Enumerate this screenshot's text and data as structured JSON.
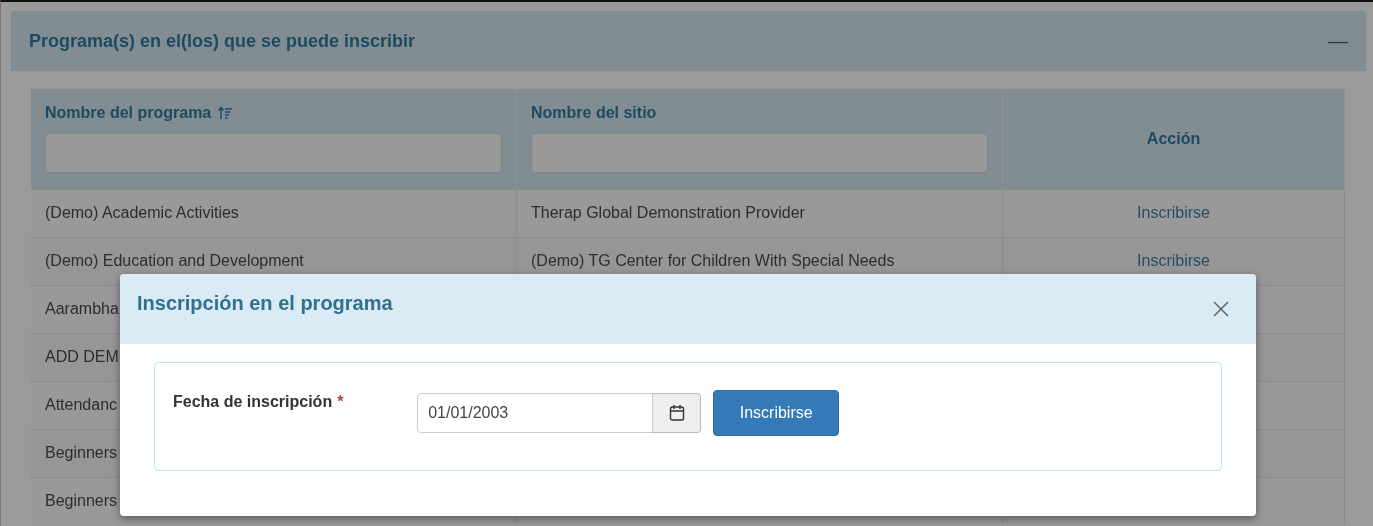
{
  "panel": {
    "title": "Programa(s) en el(los) que se puede inscribir",
    "collapse_icon": "—"
  },
  "table": {
    "columns": [
      {
        "label": "Nombre del programa",
        "sorted": true,
        "filter": true
      },
      {
        "label": "Nombre del sitio",
        "sorted": false,
        "filter": true
      },
      {
        "label": "Acción",
        "sorted": false,
        "filter": false
      }
    ],
    "rows": [
      {
        "program": "(Demo) Academic Activities",
        "site": "Therap Global Demonstration Provider",
        "action": "Inscribirse"
      },
      {
        "program": "(Demo) Education and Development",
        "site": "(Demo) TG Center for Children With Special Needs",
        "action": "Inscribirse"
      },
      {
        "program": "Aarambha"
      },
      {
        "program": "ADD DEM"
      },
      {
        "program": "Attendanc"
      },
      {
        "program": "Beginners"
      },
      {
        "program": "Beginners"
      }
    ]
  },
  "modal": {
    "title": "Inscripción en el programa",
    "field_label": "Fecha de inscripción",
    "required_mark": "*",
    "date_value": "01/01/2003",
    "button": "Inscribirse"
  }
}
